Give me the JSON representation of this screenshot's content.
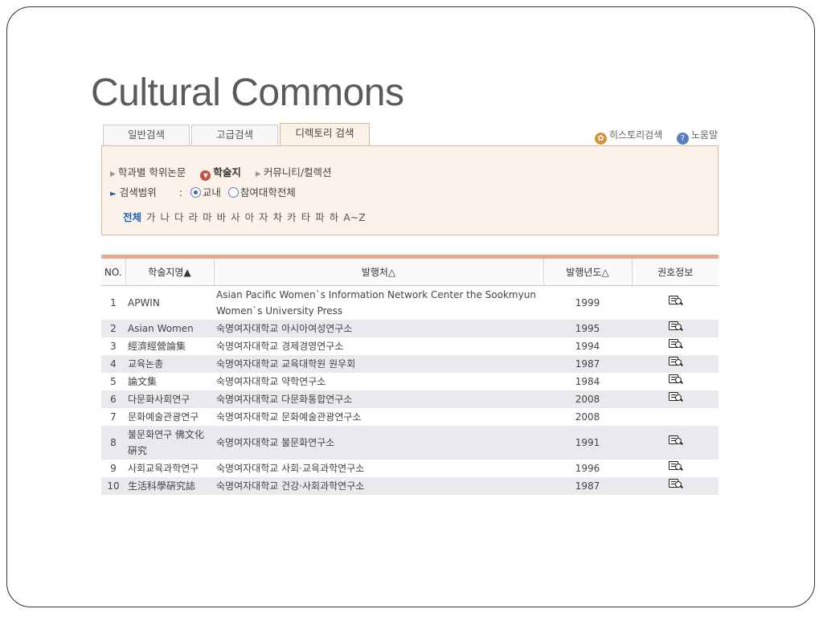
{
  "slide": {
    "title": "Cultural Commons"
  },
  "tabs": [
    {
      "label": "일반검색"
    },
    {
      "label": "고급검색"
    },
    {
      "label": "디렉토리 검색"
    }
  ],
  "utility": {
    "history": "히스토리검색",
    "hint": "노움말"
  },
  "filter": {
    "categories": [
      "학과별 학위논문",
      "학술지",
      "커뮤니티/컬렉션"
    ],
    "scope_label": "검색범위",
    "scope_sep": ":",
    "scope_options": [
      "교내",
      "참여대학전체"
    ],
    "letters": [
      "전체",
      "가",
      "나",
      "다",
      "라",
      "마",
      "바",
      "사",
      "아",
      "자",
      "차",
      "카",
      "타",
      "파",
      "하",
      "A~Z"
    ]
  },
  "table": {
    "headers": [
      "NO.",
      "학술지명▲",
      "발행처△",
      "발행년도△",
      "권호정보"
    ],
    "rows": [
      {
        "no": "1",
        "name": "APWIN",
        "publisher": "Asian Pacific Women`s Information Network Center the Sookmyun Women`s University Press",
        "year": "1999",
        "info": true
      },
      {
        "no": "2",
        "name": "Asian Women",
        "publisher": "숙명여자대학교 아시아여성연구소",
        "year": "1995",
        "info": true
      },
      {
        "no": "3",
        "name": "經濟經營論集",
        "publisher": "숙명여자대학교 경제경영연구소",
        "year": "1994",
        "info": true
      },
      {
        "no": "4",
        "name": "교육논총",
        "publisher": "숙명여자대학교 교육대학원 원우회",
        "year": "1987",
        "info": true
      },
      {
        "no": "5",
        "name": "論文集",
        "publisher": "숙명여자대학교 약학연구소",
        "year": "1984",
        "info": true
      },
      {
        "no": "6",
        "name": "다문화사회연구",
        "publisher": "숙명여자대학교 다문화통합연구소",
        "year": "2008",
        "info": true
      },
      {
        "no": "7",
        "name": "문화예술관광연구",
        "publisher": "숙명여자대학교 문화예술관광연구소",
        "year": "2008",
        "info": false
      },
      {
        "no": "8",
        "name": "불문화연구 佛文化硏究",
        "publisher": "숙명여자대학교 불문화연구소",
        "year": "1991",
        "info": true
      },
      {
        "no": "9",
        "name": "사회교육과학연구",
        "publisher": "숙명여자대학교 사회·교육과학연구소",
        "year": "1996",
        "info": true
      },
      {
        "no": "10",
        "name": "生活科學硏究誌",
        "publisher": "숙명여자대학교 건강·사회과학연구소",
        "year": "1987",
        "info": true
      }
    ]
  },
  "icons": {
    "info": "book-magnifier-icon",
    "history": "history-search-icon",
    "hint": "help-icon"
  },
  "colors": {
    "panel_bg": "#fbf3ea",
    "panel_border": "#d8b89a",
    "table_accent": "#e5a98c",
    "letter_active": "#1d5fb5"
  }
}
